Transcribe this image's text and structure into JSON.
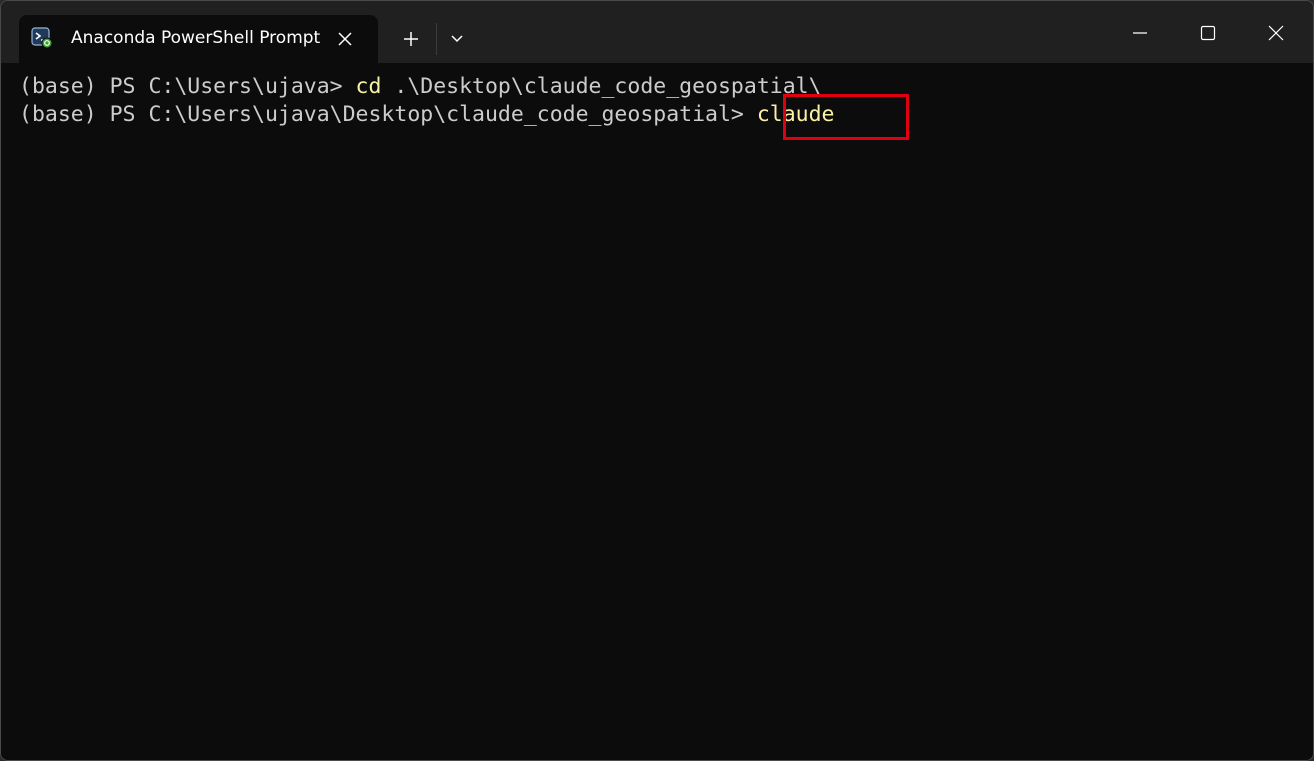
{
  "window": {
    "tab_title": "Anaconda PowerShell Prompt",
    "tab_icon": "powershell-anaconda-icon",
    "new_tab_glyph": "+",
    "colors": {
      "terminal_bg": "#0c0c0c",
      "titlebar_bg": "#202020",
      "text": "#cccccc",
      "command": "#f9f1a5",
      "highlight": "#e0000f"
    }
  },
  "terminal": {
    "lines": [
      {
        "prompt": "(base) PS C:\\Users\\ujava> ",
        "command": "cd",
        "args": " .\\Desktop\\claude_code_geospatial\\"
      },
      {
        "prompt": "(base) PS C:\\Users\\ujava\\Desktop\\claude_code_geospatial> ",
        "command": "claude",
        "args": ""
      }
    ]
  }
}
